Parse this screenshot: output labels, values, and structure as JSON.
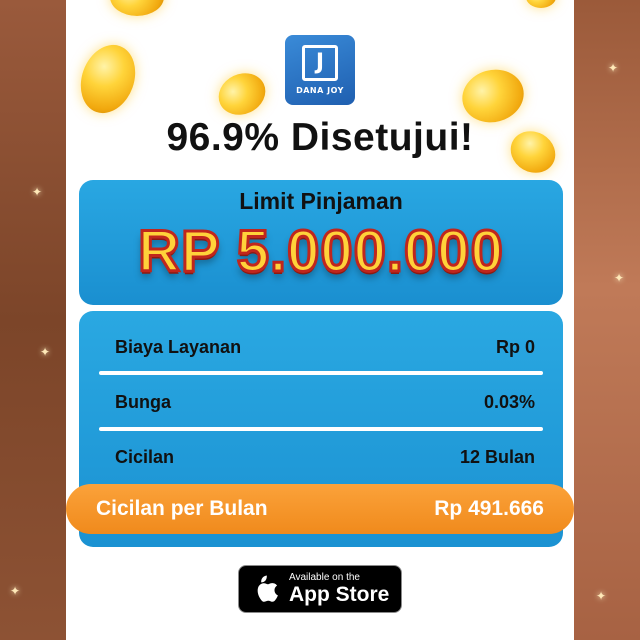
{
  "brand": {
    "logo_text": "DANA JOY",
    "logo_mark": "J"
  },
  "headline": "96.9% Disetujui!",
  "limit": {
    "label": "Limit Pinjaman",
    "amount": "RP 5.000.000"
  },
  "details": [
    {
      "label": "Biaya Layanan",
      "value": "Rp 0"
    },
    {
      "label": "Bunga",
      "value": "0.03%"
    },
    {
      "label": "Cicilan",
      "value": "12 Bulan"
    }
  ],
  "monthly": {
    "label": "Cicilan per Bulan",
    "value": "Rp 491.666"
  },
  "store_button": {
    "small": "Available on the",
    "big": "App Store",
    "icon": "apple-icon"
  },
  "colors": {
    "panel_blue": "#1f9ad6",
    "accent_orange": "#f5961f",
    "amount_yellow": "#ffd23a",
    "amount_outline": "#c0261d",
    "logo_blue": "#2a74c8"
  }
}
